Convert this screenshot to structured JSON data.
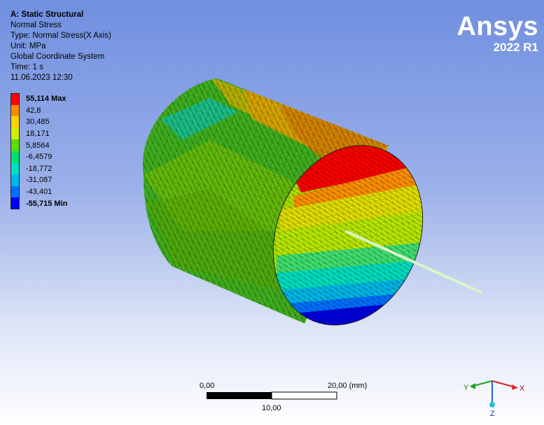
{
  "header": {
    "analysis_title": "A: Static Structural",
    "result_name": "Normal Stress",
    "result_type": "Type: Normal Stress(X Axis)",
    "unit": "Unit: MPa",
    "coordinate_system": "Global Coordinate System",
    "time": "Time: 1 s",
    "timestamp": "11.06.2023 12:30"
  },
  "legend": {
    "entries": [
      {
        "label": "55,114 Max",
        "color": "#ff0000",
        "bold": true
      },
      {
        "label": "42,8",
        "color": "#ff8c00",
        "bold": false
      },
      {
        "label": "30,485",
        "color": "#ffd400",
        "bold": false
      },
      {
        "label": "18,171",
        "color": "#d0f000",
        "bold": false
      },
      {
        "label": "5,8564",
        "color": "#5ce000",
        "bold": false
      },
      {
        "label": "-6,4579",
        "color": "#00e070",
        "bold": false
      },
      {
        "label": "-18,772",
        "color": "#00e0c0",
        "bold": false
      },
      {
        "label": "-31,087",
        "color": "#00b8e8",
        "bold": false
      },
      {
        "label": "-43,401",
        "color": "#0070ff",
        "bold": false
      },
      {
        "label": "-55,715 Min",
        "color": "#0000ff",
        "bold": true
      }
    ]
  },
  "brand": {
    "name": "Ansys",
    "version": "2022 R1"
  },
  "scale_bar": {
    "start_label": "0,00",
    "end_label": "20,00 (mm)",
    "mid_label": "10,00"
  },
  "triad": {
    "x_label": "X",
    "y_label": "Y",
    "z_label": "Z"
  }
}
